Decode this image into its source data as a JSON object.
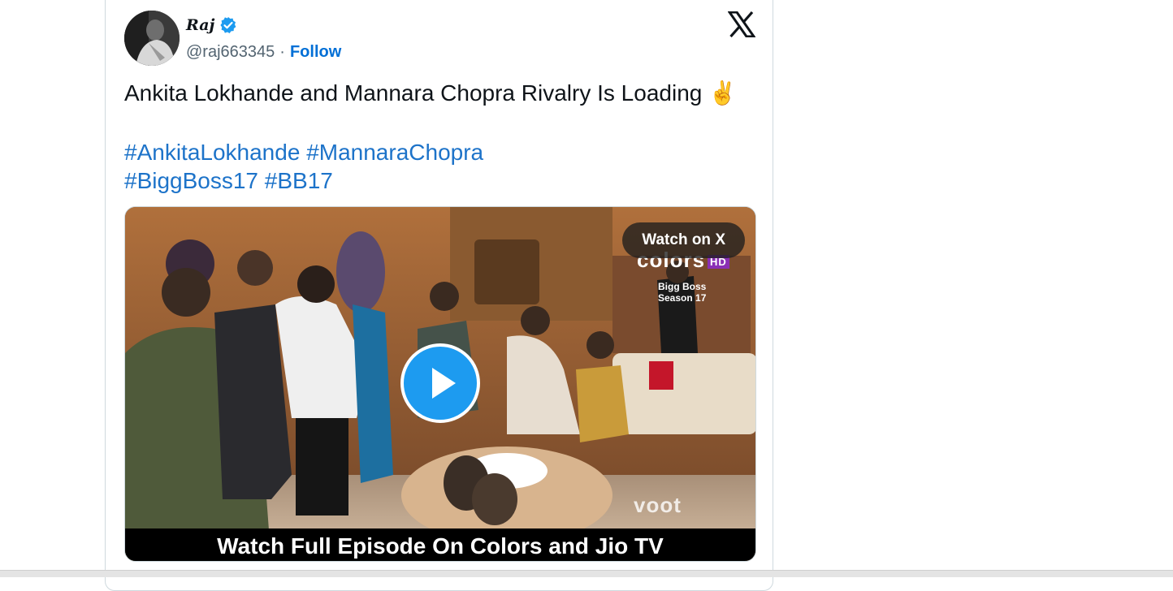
{
  "tweet": {
    "author_name": "Raj",
    "handle": "@raj663345",
    "separator": "·",
    "follow_label": "Follow",
    "text": "Ankita Lokhande and Mannara Chopra Rivalry Is Loading ✌️",
    "hashtags_line1": [
      "#AnkitaLokhande",
      "#MannaraChopra"
    ],
    "hashtags_line2": [
      "#BiggBoss17",
      "#BB17"
    ]
  },
  "media": {
    "watch_button": "Watch on X",
    "caption": "Watch Full Episode On Colors and Jio TV",
    "brand_overlay": "colors",
    "brand_hd": "HD",
    "season_overlay_line1": "Bigg Boss",
    "season_overlay_line2": "Season 17",
    "watermark": "voot"
  },
  "colors": {
    "link": "#1d73c9",
    "follow": "#006fd6",
    "play_button": "#1d9bf0",
    "verified": "#1d9bf0"
  }
}
